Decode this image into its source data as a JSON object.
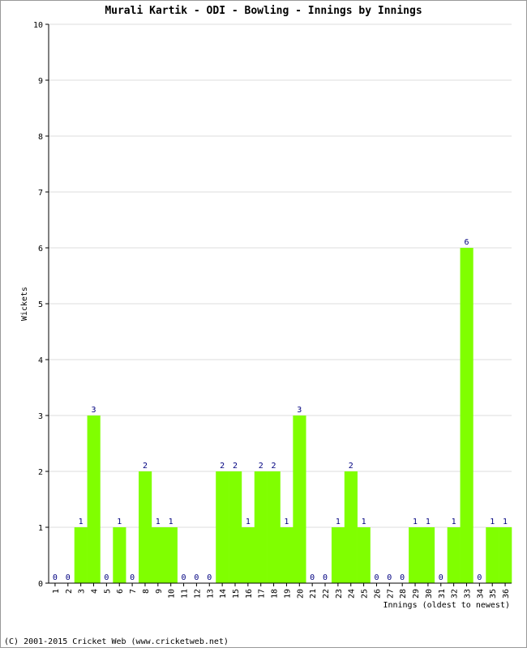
{
  "chart_data": {
    "type": "bar",
    "title": "Murali Kartik - ODI - Bowling - Innings by Innings",
    "xlabel": "Innings (oldest to newest)",
    "ylabel": "Wickets",
    "ylim": [
      0,
      10
    ],
    "yticks": [
      0,
      1,
      2,
      3,
      4,
      5,
      6,
      7,
      8,
      9,
      10
    ],
    "grid": true,
    "categories": [
      "1",
      "2",
      "3",
      "4",
      "5",
      "6",
      "7",
      "8",
      "9",
      "10",
      "11",
      "12",
      "13",
      "14",
      "15",
      "16",
      "17",
      "18",
      "19",
      "20",
      "21",
      "22",
      "23",
      "24",
      "25",
      "26",
      "27",
      "28",
      "29",
      "30",
      "31",
      "32",
      "33",
      "34",
      "35",
      "36"
    ],
    "values": [
      0,
      0,
      1,
      3,
      0,
      1,
      0,
      2,
      1,
      1,
      0,
      0,
      0,
      2,
      2,
      1,
      2,
      2,
      1,
      3,
      0,
      0,
      1,
      2,
      1,
      0,
      0,
      0,
      1,
      1,
      0,
      1,
      6,
      0,
      1,
      1
    ],
    "bar_color": "#80ff00",
    "label_color": "#000080"
  },
  "footer": "(C) 2001-2015 Cricket Web (www.cricketweb.net)"
}
